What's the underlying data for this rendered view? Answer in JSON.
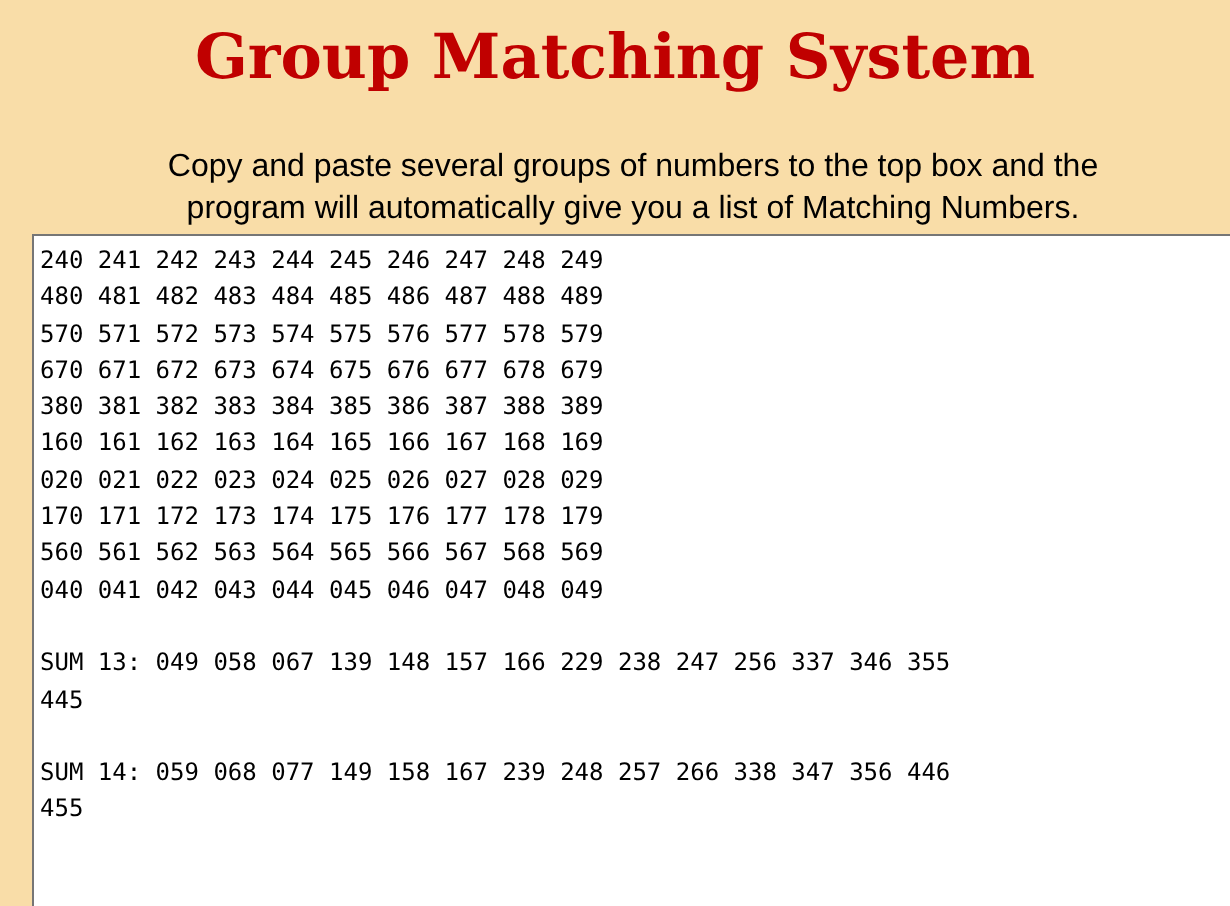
{
  "title": "Group Matching System",
  "instructions": "Copy and paste several groups of numbers to the top box and the program will automatically give you a list of Matching Numbers.",
  "input_box": {
    "blocks": [
      {
        "lines": [
          "240 241 242 243 244 245 246 247 248 249",
          "480 481 482 483 484 485 486 487 488 489",
          "570 571 572 573 574 575 576 577 578 579",
          "670 671 672 673 674 675 676 677 678 679",
          "380 381 382 383 384 385 386 387 388 389",
          "160 161 162 163 164 165 166 167 168 169",
          "020 021 022 023 024 025 026 027 028 029",
          "170 171 172 173 174 175 176 177 178 179",
          "560 561 562 563 564 565 566 567 568 569",
          "040 041 042 043 044 045 046 047 048 049"
        ]
      },
      {
        "lines": [
          "SUM 13: 049 058 067 139 148 157 166 229 238 247 256 337 346 355",
          "445"
        ]
      },
      {
        "lines": [
          "SUM 14: 059 068 077 149 158 167 239 248 257 266 338 347 356 446",
          "455"
        ]
      }
    ]
  }
}
